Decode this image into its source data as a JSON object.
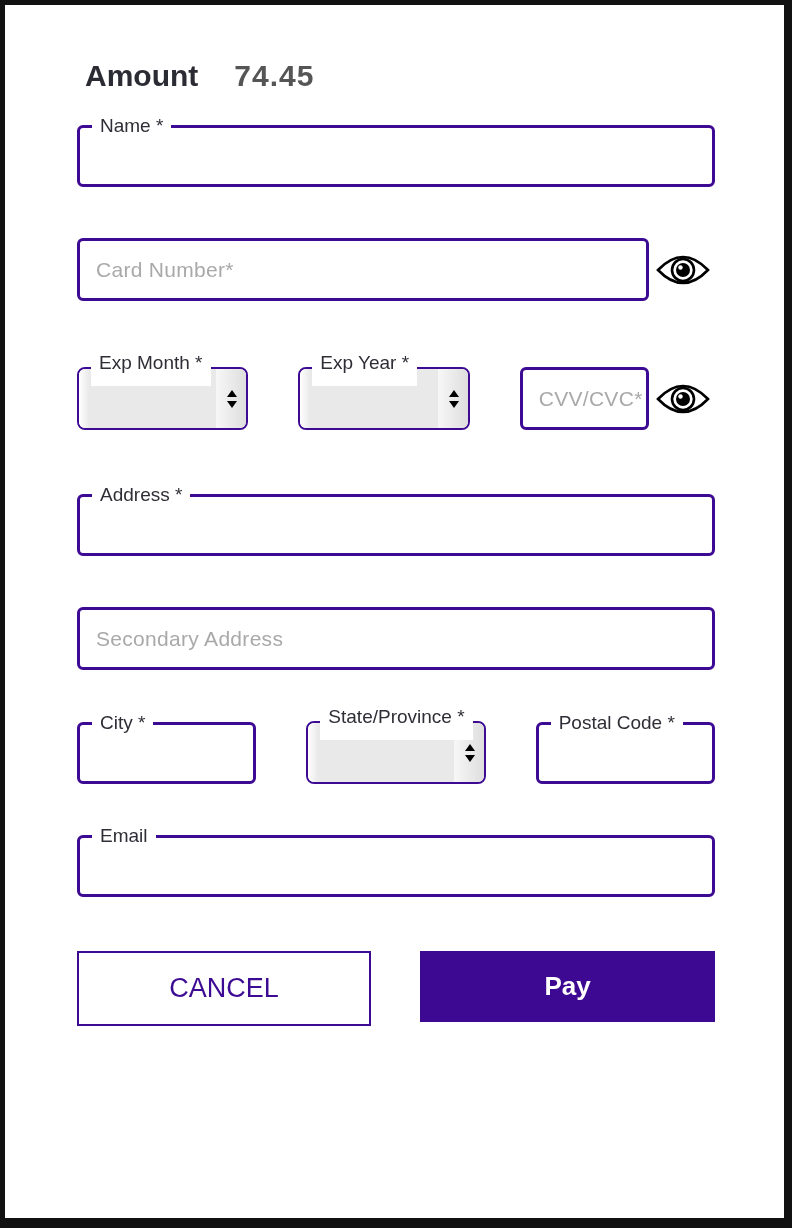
{
  "amount": {
    "label": "Amount",
    "value": "74.45"
  },
  "form_rows": [
    [
      {
        "kind": "input",
        "label": "Name *"
      }
    ],
    [
      {
        "kind": "input",
        "placeholder": "Card Number*",
        "reveal": true
      }
    ],
    [
      {
        "kind": "select",
        "label": "Exp Month *"
      },
      {
        "kind": "select",
        "label": "Exp Year *"
      },
      {
        "kind": "input",
        "placeholder": "CVV/CVC*",
        "reveal": true
      }
    ],
    [
      {
        "kind": "input",
        "label": "Address *"
      }
    ],
    [
      {
        "kind": "input",
        "placeholder": "Secondary Address"
      }
    ],
    [
      {
        "kind": "input",
        "label": "City *"
      },
      {
        "kind": "select",
        "label": "State/Province *"
      },
      {
        "kind": "input",
        "label": "Postal Code *"
      }
    ],
    [
      {
        "kind": "input",
        "label": "Email"
      }
    ]
  ],
  "buttons": [
    {
      "kind": "outline",
      "label": "CANCEL"
    },
    {
      "kind": "filled",
      "label": "Pay"
    }
  ]
}
